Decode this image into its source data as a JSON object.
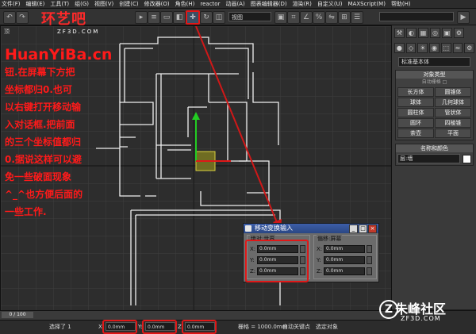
{
  "menu": [
    "文件(F)",
    "编辑(E)",
    "工具(T)",
    "组(G)",
    "视图(V)",
    "创建(C)",
    "修改器(O)",
    "角色(H)",
    "reactor",
    "动画(A)",
    "图表编辑器(D)",
    "渲染(R)",
    "自定义(U)",
    "MAXScript(M)",
    "帮助(H)"
  ],
  "toolbar": {
    "view_dropdown": "视图",
    "selection_set": ""
  },
  "viewport": {
    "label": "顶"
  },
  "overlay_text": [
    "钮.在屏幕下方把",
    "坐标都归0.也可",
    "以右键打开移动输",
    "入对话框.把前面",
    "的三个坐标值都归",
    "0.据说这样可以避",
    "免一些破面现象",
    "^_^也方便后面的",
    "一些工作."
  ],
  "watermarks": {
    "site1_name": "环艺吧",
    "site1_url": "ZF3D.COM",
    "site2_url": "HuanYiBa.cn",
    "site3_name": "朱峰社区",
    "site3_url": "ZF3D.COM"
  },
  "command_panel": {
    "tabs": [
      "⚒",
      "◐",
      "▦",
      "◎",
      "▣",
      "⚙"
    ],
    "category": "标准基本体",
    "object_type_title": "对象类型",
    "autogrid": "自动栅格 □",
    "objects": [
      "长方体",
      "圆锥体",
      "球体",
      "几何球体",
      "圆柱体",
      "管状体",
      "圆环",
      "四棱锥",
      "茶壶",
      "平面"
    ],
    "name_color_title": "名称和颜色",
    "name_value": "层:墙"
  },
  "dialog": {
    "title": "移动变换输入",
    "absolute_title": "绝对:世界",
    "offset_title": "偏移:屏幕",
    "absolute": [
      {
        "axis": "X:",
        "value": "0.0mm"
      },
      {
        "axis": "Y:",
        "value": "0.0mm"
      },
      {
        "axis": "Z:",
        "value": "0.0mm"
      }
    ],
    "offset": [
      {
        "axis": "X:",
        "value": "0.0mm"
      },
      {
        "axis": "Y:",
        "value": "0.0mm"
      },
      {
        "axis": "Z:",
        "value": "0.0mm"
      }
    ]
  },
  "status": {
    "frame": "0 / 100",
    "selected": "选择了 1",
    "x_label": "X:",
    "x_value": "0.0mm",
    "y_label": "Y:",
    "y_value": "0.0mm",
    "z_label": "Z:",
    "z_value": "0.0mm",
    "grid": "栅格 = 1000.0mm",
    "autokey": "自动关键点",
    "select_obj": "选定对象"
  },
  "colors": {
    "highlight_red": "#e01818",
    "dialog_title_blue": "#2b4784"
  }
}
